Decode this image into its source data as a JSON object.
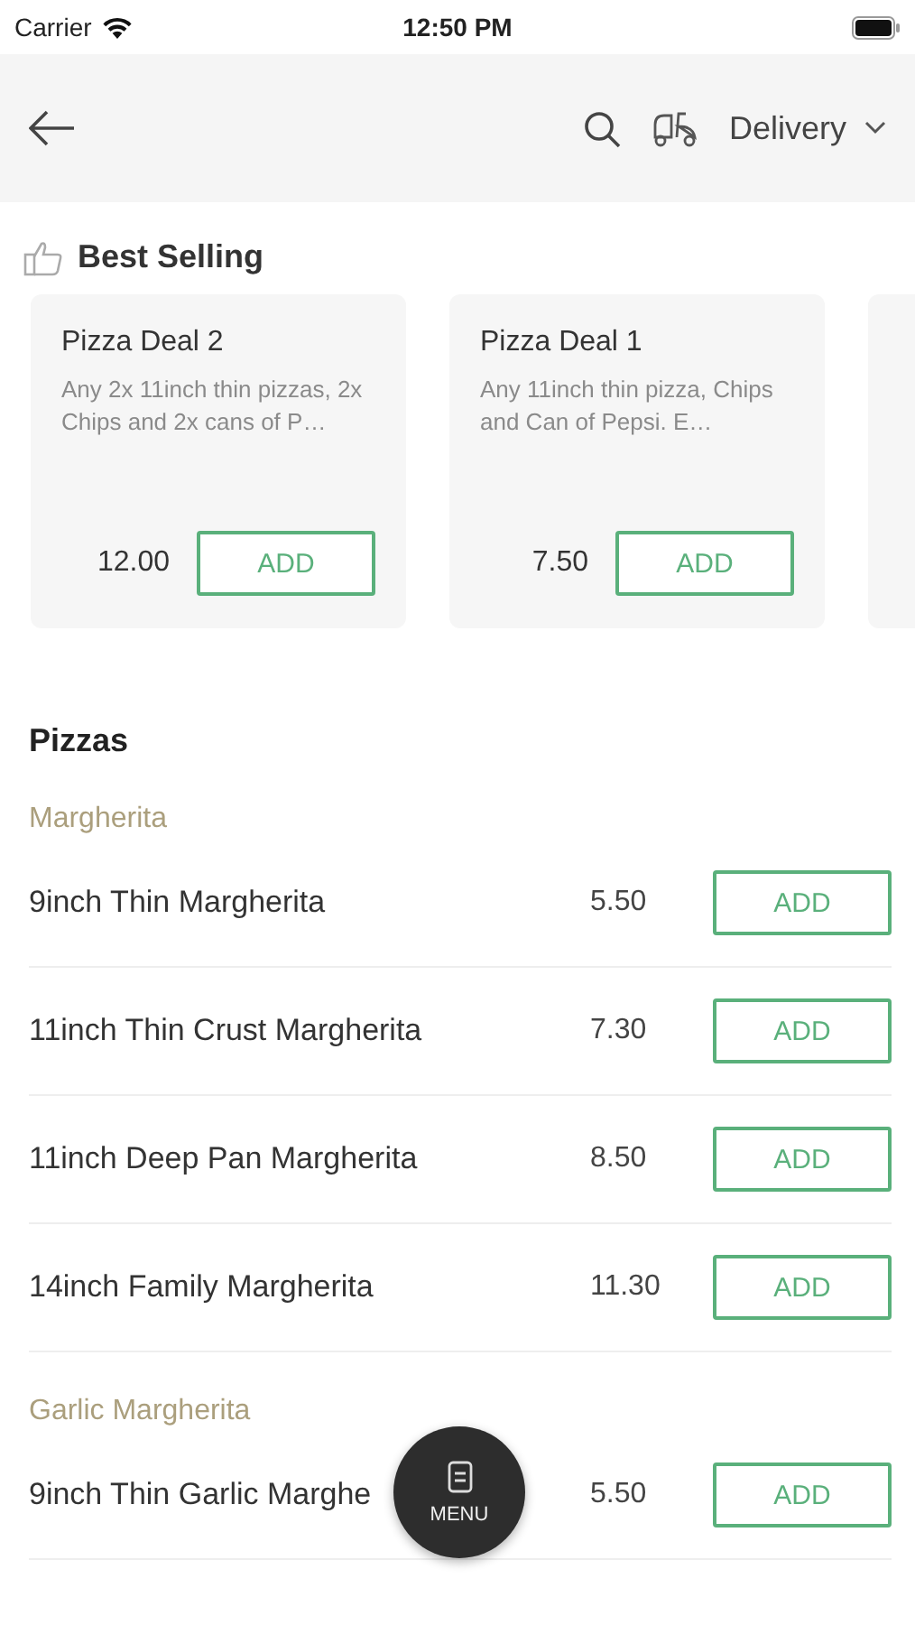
{
  "status_bar": {
    "carrier": "Carrier",
    "time": "12:50 PM"
  },
  "header": {
    "order_type": "Delivery"
  },
  "best_selling": {
    "title": "Best Selling",
    "cards": [
      {
        "name": "Pizza Deal 2",
        "description": "Any 2x 11inch thin pizzas, 2x Chips and 2x cans of P…",
        "price": "12.00",
        "button": "ADD"
      },
      {
        "name": "Pizza Deal 1",
        "description": "Any 11inch thin pizza, Chips and Can of Pepsi. E…",
        "price": "7.50",
        "button": "ADD"
      }
    ]
  },
  "category": {
    "title": "Pizzas",
    "groups": [
      {
        "title": "Margherita",
        "items": [
          {
            "name": "9inch Thin Margherita",
            "price": "5.50",
            "button": "ADD"
          },
          {
            "name": "11inch Thin Crust Margherita",
            "price": "7.30",
            "button": "ADD"
          },
          {
            "name": "11inch Deep Pan Margherita",
            "price": "8.50",
            "button": "ADD"
          },
          {
            "name": "14inch Family Margherita",
            "price": "11.30",
            "button": "ADD"
          }
        ]
      },
      {
        "title": "Garlic Margherita",
        "items": [
          {
            "name": "9inch Thin Garlic Marghe",
            "price": "5.50",
            "button": "ADD"
          }
        ]
      }
    ]
  },
  "menu_button": {
    "label": "MENU"
  }
}
